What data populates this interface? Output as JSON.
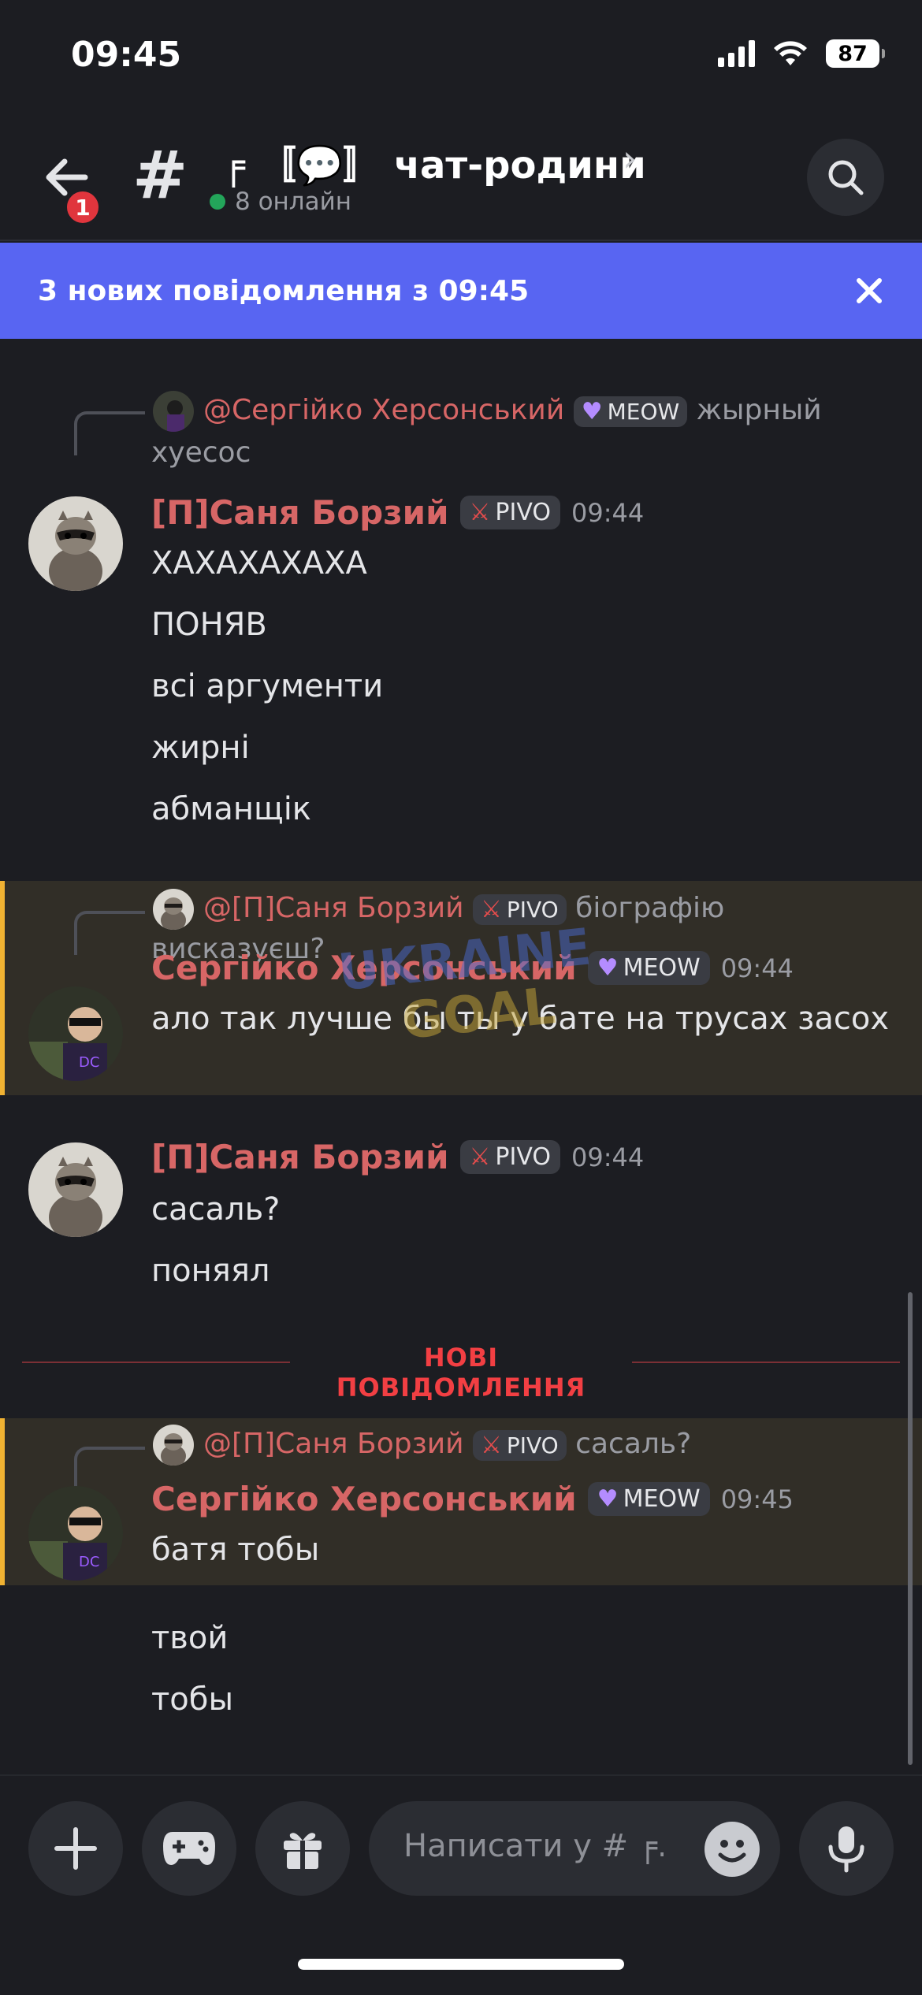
{
  "status": {
    "time": "09:45",
    "battery": "87"
  },
  "header": {
    "back_badge": "1",
    "channel_name": "╒ 〚💬〛 чат-родини",
    "online": "8 онлайн"
  },
  "banner": {
    "text": "3 нових повідомлення з 09:45"
  },
  "messages": [
    {
      "reply_mention": "@Сергійко Херсонський",
      "reply_role": "MEOW",
      "reply_text": "жырный",
      "reply_cont": "хуесос",
      "author": "[П]Саня Борзий",
      "role": "PIVO",
      "time": "09:44",
      "lines": [
        "ХАХАХАХАХА",
        "ПОНЯВ",
        "всі аргументи",
        "жирні",
        "абманщік"
      ]
    },
    {
      "reply_mention": "@[П]Саня Борзий",
      "reply_role": "PIVO",
      "reply_text": "біографію",
      "reply_cont": "висказуєш?",
      "author": "Сергійко Херсонський",
      "role": "MEOW",
      "time": "09:44",
      "lines": [
        "ало так лучше бы ты у бате на трусах засох"
      ]
    },
    {
      "author": "[П]Саня Борзий",
      "role": "PIVO",
      "time": "09:44",
      "lines": [
        "сасаль?",
        "поняял"
      ]
    },
    {
      "reply_mention": "@[П]Саня Борзий",
      "reply_role": "PIVO",
      "reply_text": "сасаль?",
      "author": "Сергійко Херсонський",
      "role": "MEOW",
      "time": "09:45",
      "lines": [
        "батя тобы",
        "твой",
        "тобы"
      ]
    }
  ],
  "divider": {
    "label": "НОВІ ПОВІДОМЛЕННЯ"
  },
  "watermark": {
    "line1": "UKRAINE",
    "line2": "GOAL"
  },
  "composer": {
    "placeholder": "Написати у # ╒..."
  },
  "colors": {
    "accent": "#5865f2",
    "author": "#d76666",
    "highlight": "#312e27",
    "highlight_bar": "#f0b232",
    "new_divider": "#f23f43"
  }
}
